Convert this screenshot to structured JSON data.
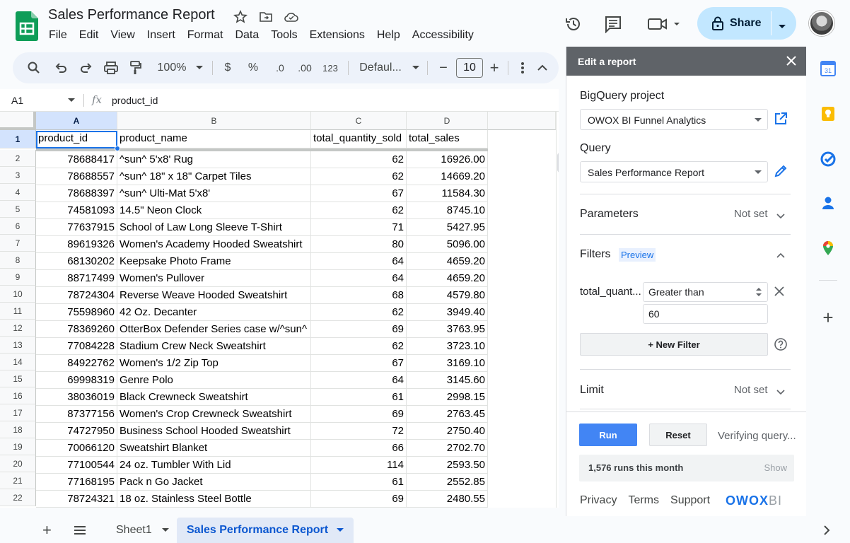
{
  "app": {
    "title": "Sales Performance Report",
    "menu": [
      "File",
      "Edit",
      "View",
      "Insert",
      "Format",
      "Data",
      "Tools",
      "Extensions",
      "Help",
      "Accessibility"
    ],
    "share_label": "Share"
  },
  "toolbar": {
    "zoom": "100%",
    "currency": "$",
    "percent": "%",
    "decimal_decrease": ".0",
    "decimal_increase": ".00",
    "format_number": "123",
    "font": "Defaul...",
    "font_size": "10",
    "minus": "−",
    "plus": "+"
  },
  "formula_bar": {
    "cell_ref": "A1",
    "fx": "fx",
    "value": "product_id"
  },
  "grid": {
    "columns": [
      "A",
      "B",
      "C",
      "D"
    ],
    "header_row": [
      "product_id",
      "product_name",
      "total_quantity_sold",
      "total_sales"
    ],
    "row_numbers": [
      "1",
      "2",
      "3",
      "4",
      "5",
      "6",
      "7",
      "8",
      "9",
      "10",
      "11",
      "12",
      "13",
      "14",
      "15",
      "16",
      "17",
      "18",
      "19",
      "20",
      "21",
      "22"
    ],
    "rows": [
      [
        "78688417",
        "^sun^ 5'x8' Rug",
        "62",
        "16926.00"
      ],
      [
        "78688557",
        "^sun^ 18\" x 18\" Carpet Tiles",
        "62",
        "14669.20"
      ],
      [
        "78688397",
        "^sun^ Ulti-Mat 5'x8'",
        "67",
        "11584.30"
      ],
      [
        "74581093",
        "14.5\" Neon Clock",
        "62",
        "8745.10"
      ],
      [
        "77637915",
        "School of Law Long Sleeve T-Shirt",
        "71",
        "5427.95"
      ],
      [
        "89619326",
        "Women's Academy Hooded Sweatshirt",
        "80",
        "5096.00"
      ],
      [
        "68130202",
        "Keepsake Photo Frame",
        "64",
        "4659.20"
      ],
      [
        "88717499",
        "Women's Pullover",
        "64",
        "4659.20"
      ],
      [
        "78724304",
        "Reverse Weave Hooded Sweatshirt",
        "68",
        "4579.80"
      ],
      [
        "75598960",
        "42 Oz. Decanter",
        "62",
        "3949.40"
      ],
      [
        "78369260",
        "OtterBox Defender Series case w/^sun^",
        "69",
        "3763.95"
      ],
      [
        "77084228",
        "Stadium Crew Neck Sweatshirt",
        "62",
        "3723.10"
      ],
      [
        "84922762",
        "Women's 1/2 Zip Top",
        "67",
        "3169.10"
      ],
      [
        "69998319",
        "Genre Polo",
        "64",
        "3145.60"
      ],
      [
        "38036019",
        "Black Crewneck Sweatshirt",
        "61",
        "2998.15"
      ],
      [
        "87377156",
        "Women's Crop Crewneck Sweatshirt",
        "69",
        "2763.45"
      ],
      [
        "74727950",
        "Business School Hooded Sweatshirt",
        "72",
        "2750.40"
      ],
      [
        "70066120",
        "Sweatshirt Blanket",
        "66",
        "2702.70"
      ],
      [
        "77100544",
        "24 oz. Tumbler With Lid",
        "114",
        "2593.50"
      ],
      [
        "77168195",
        "Pack n Go Jacket",
        "61",
        "2552.85"
      ],
      [
        "78724321",
        "18 oz. Stainless Steel Bottle",
        "69",
        "2480.55"
      ]
    ]
  },
  "sheets": {
    "add": "+",
    "tabs": [
      "Sheet1",
      "Sales Performance Report"
    ],
    "active": "Sales Performance Report"
  },
  "panel": {
    "title": "Edit a report",
    "bq_project_label": "BigQuery project",
    "bq_project_value": "OWOX BI Funnel Analytics",
    "query_label": "Query",
    "query_value": "Sales Performance Report",
    "parameters_label": "Parameters",
    "parameters_value": "Not set",
    "filters_label": "Filters",
    "filters_badge": "Preview",
    "filter_field": "total_quant...",
    "filter_operator": "Greater than",
    "filter_value": "60",
    "new_filter_label": "+ New Filter",
    "limit_label": "Limit",
    "limit_value": "Not set",
    "run_label": "Run",
    "reset_label": "Reset",
    "status": "Verifying query...",
    "runs": "1,576 runs this month",
    "show": "Show",
    "links": [
      "Privacy",
      "Terms",
      "Support"
    ],
    "brand_main": "OWOX",
    "brand_sub": "BI"
  },
  "side_apps": {
    "calendar_day": "31",
    "add": "+"
  },
  "colors": {
    "accent": "#1a73e8",
    "share_bg": "#c2e7ff",
    "sheets_green": "#0f9d58",
    "panel_header": "#5f6368"
  }
}
